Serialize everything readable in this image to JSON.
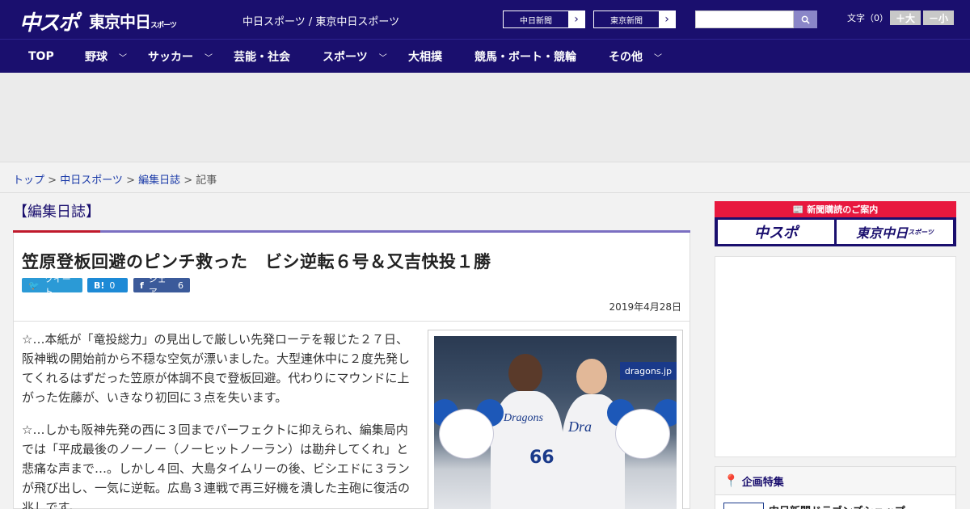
{
  "header": {
    "logo_main": "中スポ",
    "logo_tokyo": "東京中日",
    "logo_tokyo_small": "スポーツ",
    "site_links": "中日スポーツ / 東京中日スポーツ",
    "newspaper_chunichi": "中日新聞",
    "newspaper_tokyo": "東京新聞",
    "search_placeholder": "",
    "font_size_label": "文字（0）",
    "font_plus": "＋大",
    "font_minus": "－小"
  },
  "nav": {
    "items": [
      {
        "label": "TOP",
        "has_dropdown": false
      },
      {
        "label": "野球",
        "has_dropdown": true
      },
      {
        "label": "サッカー",
        "has_dropdown": true
      },
      {
        "label": "芸能・社会",
        "has_dropdown": false
      },
      {
        "label": "スポーツ",
        "has_dropdown": true
      },
      {
        "label": "大相撲",
        "has_dropdown": false
      },
      {
        "label": "競馬・ボート・競輪",
        "has_dropdown": false
      },
      {
        "label": "その他",
        "has_dropdown": true
      }
    ],
    "chevron": "﹀"
  },
  "breadcrumb": {
    "items": [
      "トップ",
      "中日スポーツ",
      "編集日誌"
    ],
    "current": "記事",
    "separator": " > "
  },
  "article": {
    "category": "【編集日誌】",
    "title": "笠原登板回避のピンチ救った　ビシ逆転６号＆又吉快投１勝",
    "share": {
      "tweet": "ツイート",
      "hatena_icon": "B!",
      "hatena_count": "0",
      "facebook_icon": "f",
      "facebook_label": "シェア",
      "facebook_count": "6"
    },
    "date": "2019年4月28日",
    "paragraphs": [
      "☆…本紙が「竜投総力」の見出しで厳しい先発ローテを報じた２７日、阪神戦の開始前から不穏な空気が漂いました。大型連休中に２度先発してくれるはずだった笠原が体調不良で登板回避。代わりにマウンドに上がった佐藤が、いきなり初回に３点を失います。",
      "☆…しかも阪神先発の西に３回までパーフェクトに抑えられ、編集局内では「平成最後のノーノー（ノーヒットノーラン）は勘弁してくれ」と悲痛な声まで…。しかし４回、大島タイムリーの後、ビシエドに３ランが飛び出し、一気に逆転。広島３連戦で再三好機を潰した主砲に復活の兆しです。"
    ],
    "photo": {
      "banner": "dragons.jp",
      "jersey_1": "Dragons",
      "number_1": "66",
      "jersey_2": "Dra"
    }
  },
  "sidebar": {
    "subscribe_head": "新聞購読のご案内",
    "subscribe_chuspo": "中スポ",
    "subscribe_tokyo": "東京中日",
    "subscribe_tokyo_small": "スポーツ",
    "feature_head": "企画特集",
    "feature_item": "中日新聞ドラゴンズショップ"
  }
}
